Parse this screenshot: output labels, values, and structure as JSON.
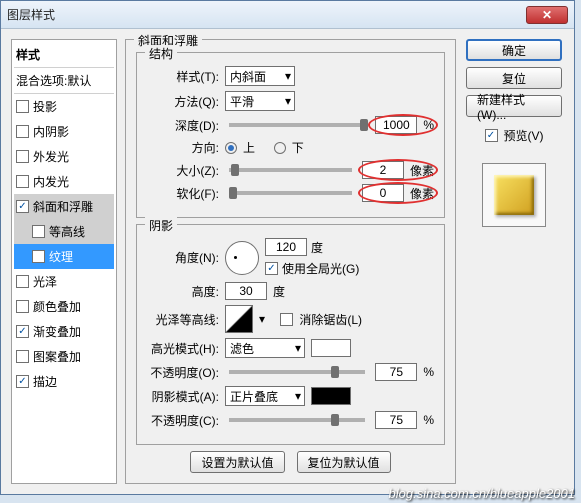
{
  "window": {
    "title": "图层样式"
  },
  "left": {
    "header": "样式",
    "subheader": "混合选项:默认",
    "items": [
      {
        "label": "投影",
        "checked": false
      },
      {
        "label": "内阴影",
        "checked": false
      },
      {
        "label": "外发光",
        "checked": false
      },
      {
        "label": "内发光",
        "checked": false
      },
      {
        "label": "斜面和浮雕",
        "checked": true
      },
      {
        "label": "等高线",
        "checked": false
      },
      {
        "label": "纹理",
        "checked": false
      },
      {
        "label": "光泽",
        "checked": false
      },
      {
        "label": "颜色叠加",
        "checked": false
      },
      {
        "label": "渐变叠加",
        "checked": true
      },
      {
        "label": "图案叠加",
        "checked": false
      },
      {
        "label": "描边",
        "checked": true
      }
    ]
  },
  "mid": {
    "title": "斜面和浮雕",
    "structGroup": "结构",
    "styleLbl": "样式(T):",
    "styleVal": "内斜面",
    "methodLbl": "方法(Q):",
    "methodVal": "平滑",
    "depthLbl": "深度(D):",
    "depthVal": "1000",
    "depthUnit": "%",
    "dirLbl": "方向:",
    "dirUp": "上",
    "dirDown": "下",
    "sizeLbl": "大小(Z):",
    "sizeVal": "2",
    "sizeUnit": "像素",
    "softLbl": "软化(F):",
    "softVal": "0",
    "softUnit": "像素",
    "shadowGroup": "阴影",
    "angleLbl": "角度(N):",
    "angleVal": "120",
    "angleUnit": "度",
    "globalLbl": "使用全局光(G)",
    "altLbl": "高度:",
    "altVal": "30",
    "altUnit": "度",
    "glossLbl": "光泽等高线:",
    "antiLbl": "消除锯齿(L)",
    "hiLbl": "高光模式(H):",
    "hiVal": "滤色",
    "hiOpLbl": "不透明度(O):",
    "hiOpVal": "75",
    "pct": "%",
    "shLbl": "阴影模式(A):",
    "shVal": "正片叠底",
    "shOpLbl": "不透明度(C):",
    "shOpVal": "75",
    "setDefault": "设置为默认值",
    "resetDefault": "复位为默认值"
  },
  "right": {
    "ok": "确定",
    "cancel": "复位",
    "newStyle": "新建样式(W)...",
    "preview": "预览(V)"
  },
  "watermark": "blog.sina.com.cn/blueapple2001"
}
